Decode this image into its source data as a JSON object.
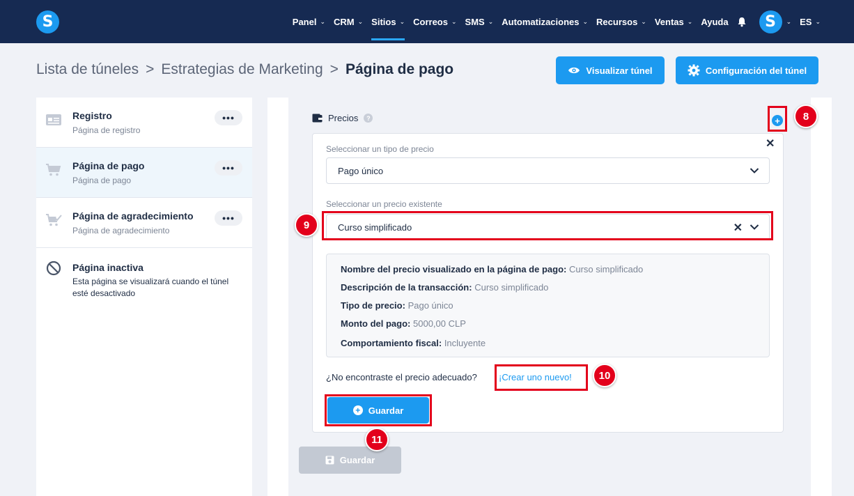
{
  "nav": {
    "items": [
      {
        "label": "Panel",
        "chevron": true
      },
      {
        "label": "CRM",
        "chevron": true
      },
      {
        "label": "Sitios",
        "chevron": true,
        "active": true
      },
      {
        "label": "Correos",
        "chevron": true
      },
      {
        "label": "SMS",
        "chevron": true
      },
      {
        "label": "Automatizaciones",
        "chevron": true
      },
      {
        "label": "Recursos",
        "chevron": true
      },
      {
        "label": "Ventas",
        "chevron": true
      },
      {
        "label": "Ayuda",
        "chevron": false
      }
    ],
    "logo_letter": "S",
    "avatar_letter": "S",
    "language": "ES"
  },
  "breadcrumb": {
    "part1": "Lista de túneles",
    "part2": "Estrategias de Marketing",
    "current": "Página de pago",
    "separator": ">"
  },
  "header_buttons": {
    "view": "Visualizar túnel",
    "config": "Configuración del túnel"
  },
  "sidebar": {
    "steps": [
      {
        "title": "Registro",
        "sub": "Página de registro",
        "icon": "form-icon"
      },
      {
        "title": "Página de pago",
        "sub": "Página de pago",
        "icon": "cart-icon"
      },
      {
        "title": "Página de agradecimiento",
        "sub": "Página de agradecimiento",
        "icon": "cart-check-icon"
      }
    ],
    "dots": "•••",
    "inactive": {
      "title": "Página inactiva",
      "desc": "Esta página se visualizará cuando el túnel esté desactivado"
    }
  },
  "pricing": {
    "title": "Precios",
    "help": "?",
    "type_label": "Seleccionar un tipo de precio",
    "type_value": "Pago único",
    "existing_label": "Seleccionar un precio existente",
    "existing_value": "Curso simplificado",
    "summary": [
      {
        "label": "Nombre del precio visualizado en la página de pago:",
        "value": "Curso simplificado"
      },
      {
        "label": "Descripción de la transacción:",
        "value": "Curso simplificado"
      },
      {
        "label": "Tipo de precio:",
        "value": "Pago único"
      },
      {
        "label": "Monto del pago:",
        "value": "5000,00 CLP"
      },
      {
        "label": "Comportamiento fiscal:",
        "value": "Incluyente"
      }
    ],
    "not_found": "¿No encontraste el precio adecuado?",
    "create_link": "¡Crear uno nuevo!",
    "save": "Guardar"
  },
  "page_save": "Guardar",
  "annotations": [
    "8",
    "9",
    "10",
    "11"
  ],
  "colors": {
    "nav_bg": "#162a52",
    "accent": "#1c9af0",
    "annotation": "#e3001b"
  }
}
